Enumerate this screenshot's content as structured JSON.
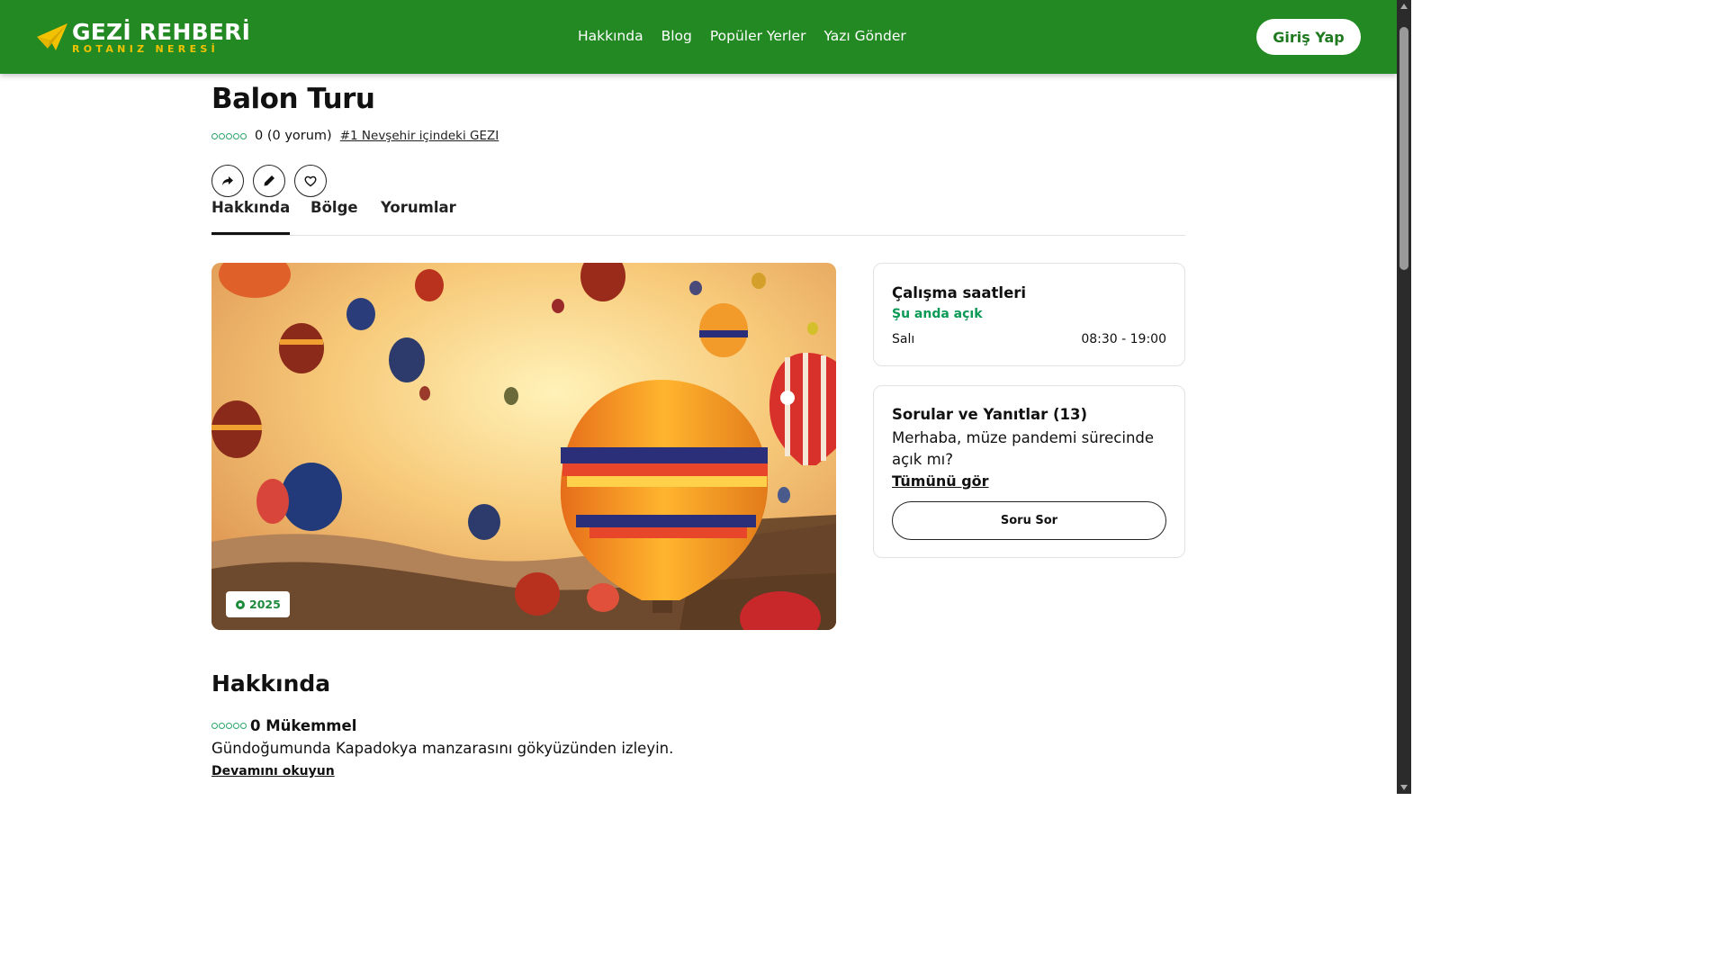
{
  "brand": {
    "title": "GEZİ REHBERİ",
    "subtitle": "ROTANIZ NERESİ"
  },
  "nav": {
    "items": [
      "Hakkında",
      "Blog",
      "Popüler Yerler",
      "Yazı Gönder"
    ]
  },
  "header": {
    "login_label": "Giriş Yap"
  },
  "page": {
    "title": "Balon Turu",
    "rating_text": "0 (0 yorum)",
    "rank_text": "#1 Nevşehir içindeki GEZI",
    "stars_filled": 0,
    "stars_total": 5
  },
  "actions": {
    "icons": [
      "share-icon",
      "edit-icon",
      "heart-icon"
    ]
  },
  "tabs": [
    "Hakkında",
    "Bölge",
    "Yorumlar"
  ],
  "hero": {
    "badge": "2025"
  },
  "hours_card": {
    "title": "Çalışma saatleri",
    "status": "Şu anda açık",
    "day": "Salı",
    "hours": "08:30 - 19:00"
  },
  "qa_card": {
    "title": "Sorular ve Yanıtlar (13)",
    "question": "Merhaba, müze pandemi sürecinde açık mı?",
    "see_all": "Tümünü gör",
    "ask_label": "Soru Sor"
  },
  "about": {
    "heading": "Hakkında",
    "rating_label": "0 Mükemmel",
    "description": "Gündoğumunda Kapadokya manzarasını gökyüzünden izleyin.",
    "read_more": "Devamını okuyun"
  },
  "colors": {
    "brand_green": "#238a23",
    "accent_yellow": "#f2c200",
    "status_green": "#0a9a55"
  }
}
